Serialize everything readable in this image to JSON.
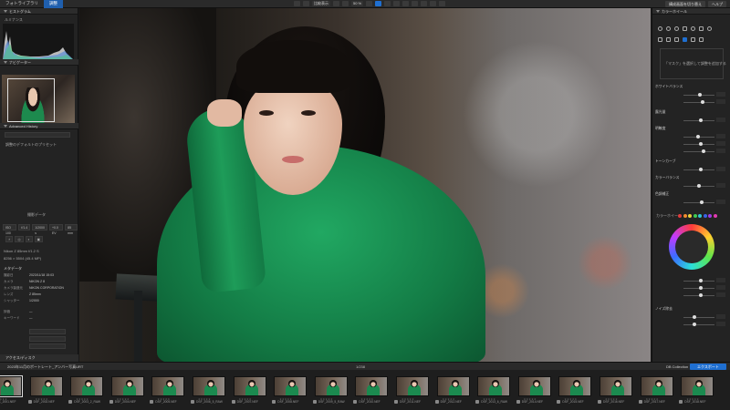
{
  "app": {
    "tabs": [
      "フォトライブラリ",
      "調整"
    ],
    "toolbar_zoom": "50 %",
    "toolbar_compare": "比較表示",
    "right_buttons": [
      "構成画面を切り替え",
      "ヘルプ"
    ]
  },
  "left_panel": {
    "histogram_title": "ヒストグラム",
    "histo_sub": "ルミナンス",
    "nav_title": "ナビゲーター",
    "adv_history_title": "Advanced History",
    "history_items": [
      "調整のデフォルトのプリセット"
    ],
    "ab_label": "撮影データ",
    "exif_chips": [
      "ISO 100",
      "f/1.4",
      "1/2000 s",
      "+0.0 EV",
      "85 mm"
    ],
    "lens": "Nikon Z 85mm f/1.2 S",
    "dimension": "8256 × 5504 (45.4 MP)",
    "metadata_title": "メタデータ",
    "meta_rows": [
      {
        "k": "撮影日",
        "v": "2023/11/18 15:03"
      },
      {
        "k": "カメラ",
        "v": "NIKON Z 8"
      },
      {
        "k": "カメラ製造元",
        "v": "NIKON CORPORATION"
      },
      {
        "k": "レンズ",
        "v": "Z 85mm"
      },
      {
        "k": "シャッター",
        "v": "1/2000"
      },
      {
        "k": "評価",
        "v": "—"
      },
      {
        "k": "キーワード",
        "v": "—"
      }
    ],
    "bottom_title": "アクセス/ディスク"
  },
  "right_panel": {
    "title": "カラーホイール",
    "hint": "「マスク」を選択して調整を追加する",
    "sections": [
      "ホワイトバランス",
      "露光量",
      "明瞭度",
      "トーンカーブ",
      "カラーバランス",
      "色調補正",
      "ノイズ除去"
    ],
    "color_wheel_label": "カラーホイール"
  },
  "filmstrip": {
    "path": "2023年11月のポートレート_アンバー写真URT",
    "count": "1/238",
    "collection": "DB Collection",
    "export_label": "エクスポート",
    "files": [
      "_DSC_2001.NEF",
      "DSF_2002.NEF",
      "DSF_2003_2_RAW",
      "DSF_2004.NEF",
      "DSF_2005.NEF",
      "DSF_2006_5_RAW",
      "DSF_2007.NEF",
      "DSF_2008.NEF",
      "DSF_2009_5_RAW",
      "DSF_2010.NEF",
      "DSF_2011.NEF",
      "DSF_2012.NEF",
      "DSF_2013_6_RAW",
      "DSF_2014.NEF",
      "DSF_2015.NEF",
      "DSF_2016.NEF",
      "DSF_2017.NEF",
      "DSF_2018.NEF"
    ]
  }
}
